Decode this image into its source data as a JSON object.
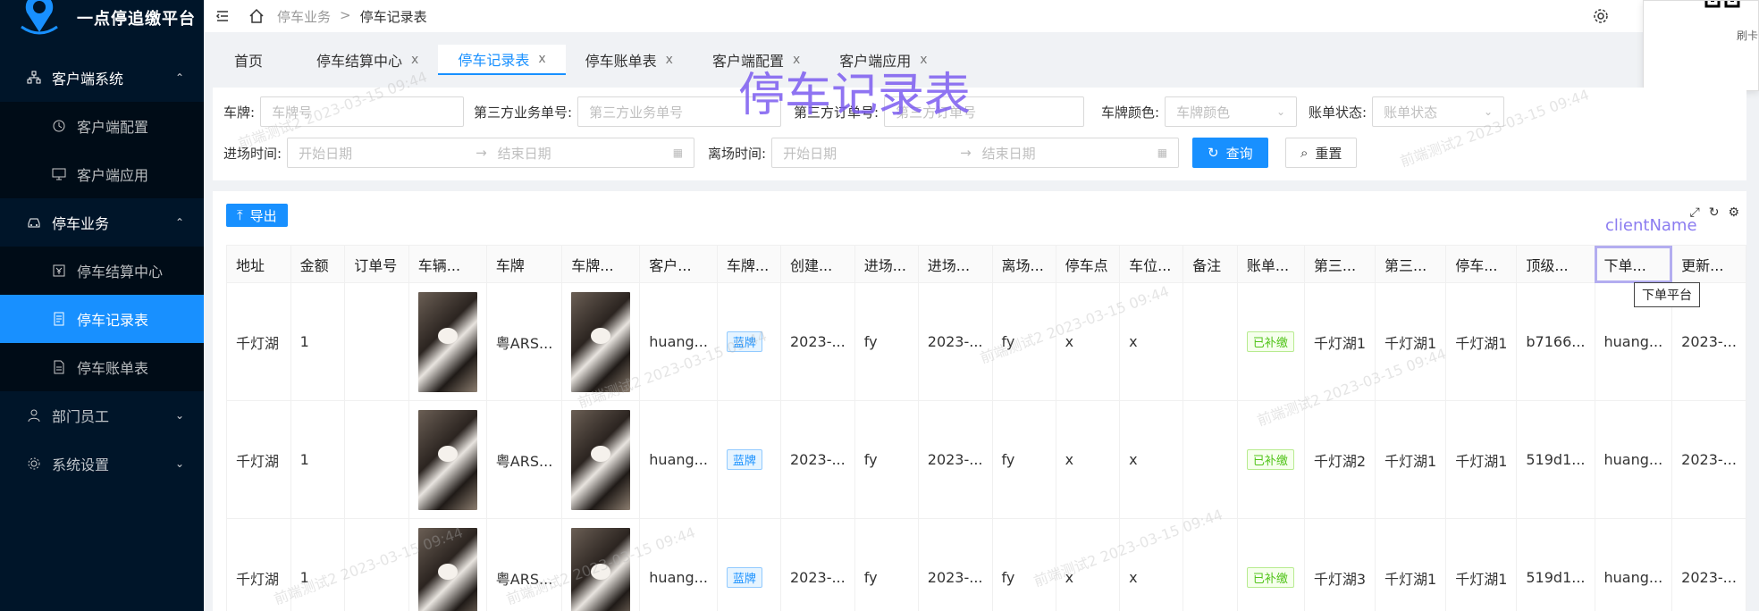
{
  "app": {
    "title": "一点停追缴平台"
  },
  "sidebar": {
    "items": [
      {
        "label": "客户端系统",
        "type": "group",
        "open": true
      },
      {
        "label": "客户端配置",
        "type": "item"
      },
      {
        "label": "客户端应用",
        "type": "item"
      },
      {
        "label": "停车业务",
        "type": "group",
        "open": true
      },
      {
        "label": "停车结算中心",
        "type": "item"
      },
      {
        "label": "停车记录表",
        "type": "item",
        "active": true
      },
      {
        "label": "停车账单表",
        "type": "item"
      },
      {
        "label": "部门员工",
        "type": "group",
        "open": false
      },
      {
        "label": "系统设置",
        "type": "group",
        "open": false
      }
    ]
  },
  "header": {
    "breadcrumb": [
      "停车业务",
      ">",
      "停车记录表"
    ]
  },
  "qr": {
    "text": "刷卡"
  },
  "tabs": [
    {
      "label": "首页"
    },
    {
      "label": "停车结算中心",
      "close": "x"
    },
    {
      "label": "停车记录表",
      "close": "x",
      "active": true
    },
    {
      "label": "停车账单表",
      "close": "x"
    },
    {
      "label": "客户端配置",
      "close": "x"
    },
    {
      "label": "客户端应用",
      "close": "x"
    }
  ],
  "page_title_overlay": "停车记录表",
  "filters": {
    "plate": {
      "label": "车牌:",
      "placeholder": "车牌号"
    },
    "third_business": {
      "label": "第三方业务单号:",
      "placeholder": "第三方业务单号"
    },
    "third_order": {
      "label": "第三方订单号:",
      "placeholder": "第三方订单号"
    },
    "plate_color": {
      "label": "车牌颜色:",
      "placeholder": "车牌颜色"
    },
    "bill_status": {
      "label": "账单状态:",
      "placeholder": "账单状态"
    },
    "entry_time": {
      "label": "进场时间:",
      "start": "开始日期",
      "end": "结束日期"
    },
    "exit_time": {
      "label": "离场时间:",
      "start": "开始日期",
      "end": "结束日期"
    },
    "query_label": "查询",
    "reset_label": "重置"
  },
  "table": {
    "export_label": "导出",
    "client_name_label": "clientName",
    "tooltip": "下单平台",
    "columns": [
      "地址",
      "金额",
      "订单号",
      "车辆...",
      "车牌",
      "车牌...",
      "客户...",
      "车牌...",
      "创建...",
      "进场...",
      "进场...",
      "离场...",
      "停车点",
      "车位...",
      "备注",
      "账单...",
      "第三...",
      "第三...",
      "停车...",
      "顶级...",
      "下单...",
      "更新..."
    ],
    "rows": [
      [
        "千灯湖",
        "1",
        "",
        "",
        "粤ARS...",
        "",
        "huang...",
        "蓝牌",
        "2023-...",
        "fy",
        "2023-...",
        "fy",
        "x",
        "x",
        "",
        "已补缴",
        "千灯湖1",
        "千灯湖1",
        "千灯湖1",
        "b7166...",
        "huang...",
        "2023-..."
      ],
      [
        "千灯湖",
        "1",
        "",
        "",
        "粤ARS...",
        "",
        "huang...",
        "蓝牌",
        "2023-...",
        "fy",
        "2023-...",
        "fy",
        "x",
        "x",
        "",
        "已补缴",
        "千灯湖2",
        "千灯湖1",
        "千灯湖1",
        "519d1...",
        "huang...",
        "2023-..."
      ],
      [
        "千灯湖",
        "1",
        "",
        "",
        "粤ARS...",
        "",
        "huang...",
        "蓝牌",
        "2023-...",
        "fy",
        "2023-...",
        "fy",
        "x",
        "x",
        "",
        "已补缴",
        "千灯湖3",
        "千灯湖1",
        "千灯湖1",
        "519d1...",
        "huang...",
        "2023-..."
      ]
    ]
  },
  "watermark": "前端测试2 2023-03-15 09:44",
  "colors": {
    "sidebar_bg": "#001529",
    "accent": "#1890ff",
    "overlay_purple": "#7c5cf0"
  }
}
